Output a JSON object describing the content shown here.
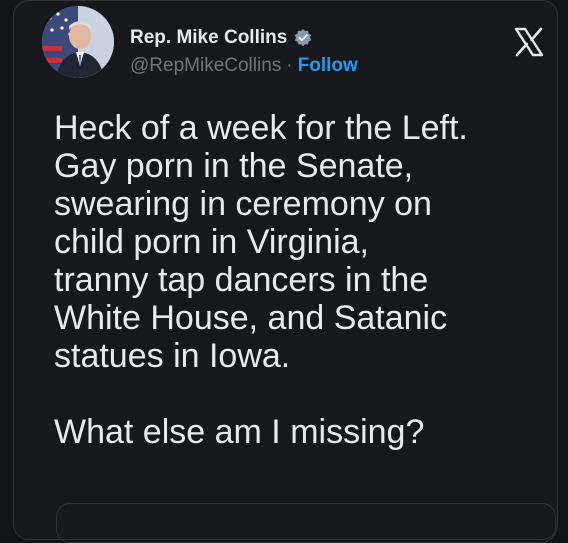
{
  "tweet": {
    "author_name": "Rep. Mike Collins",
    "handle": "@RepMikeCollins",
    "separator": "·",
    "follow_label": "Follow",
    "text": "Heck of a week for the Left.\nGay porn in the Senate,\nswearing in ceremony on\nchild porn in Virginia,\ntranny tap dancers in the\nWhite House, and Satanic\nstatues in Iowa.\n\nWhat else am I missing?"
  },
  "icons": {
    "verified": "verified-badge-icon",
    "x_logo": "x-logo-icon"
  },
  "colors": {
    "background": "#16181c",
    "text": "#e7e9ea",
    "secondary": "#71767b",
    "accent": "#1d9bf0"
  }
}
